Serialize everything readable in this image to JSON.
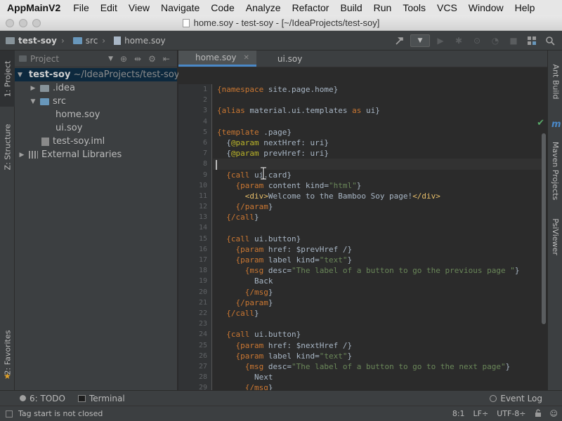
{
  "menubar": {
    "app": "AppMainV2",
    "items": [
      "File",
      "Edit",
      "View",
      "Navigate",
      "Code",
      "Analyze",
      "Refactor",
      "Build",
      "Run",
      "Tools",
      "VCS",
      "Window",
      "Help"
    ]
  },
  "window": {
    "title": "home.soy - test-soy - [~/IdeaProjects/test-soy]"
  },
  "breadcrumbs": [
    "test-soy",
    "src",
    "home.soy"
  ],
  "project_panel": {
    "header": "Project",
    "tree": [
      {
        "label": "test-soy",
        "path": "~/IdeaProjects/test-soy",
        "expanded": "▼"
      },
      {
        "label": ".idea",
        "expanded": "▶"
      },
      {
        "label": "src",
        "expanded": "▼"
      },
      {
        "label": "home.soy"
      },
      {
        "label": "ui.soy"
      },
      {
        "label": "test-soy.iml"
      },
      {
        "label": "External Libraries",
        "expanded": "▶"
      }
    ]
  },
  "left_tabs": {
    "project": "1: Project",
    "structure": "Z: Structure",
    "favorites": "2: Favorites"
  },
  "right_tabs": {
    "ant": "Ant Build",
    "maven": "Maven Projects",
    "psi": "PsiViewer"
  },
  "editor_tabs": [
    {
      "label": "home.soy",
      "active": true
    },
    {
      "label": "ui.soy",
      "active": false
    }
  ],
  "code_lines": [
    "{namespace site.page.home}",
    "",
    "{alias material.ui.templates as ui}",
    "",
    "{template .page}",
    "  {@param nextHref: uri}",
    "  {@param prevHref: uri}",
    "",
    "  {call ui.card}",
    "    {param content kind=\"html\"}",
    "      <div>Welcome to the Bamboo Soy page!</div>",
    "    {/param}",
    "  {/call}",
    "",
    "  {call ui.button}",
    "    {param href: $prevHref /}",
    "    {param label kind=\"text\"}",
    "      {msg desc=\"The label of a button to go the previous page \"}",
    "        Back",
    "      {/msg}",
    "    {/param}",
    "  {/call}",
    "",
    "  {call ui.button}",
    "    {param href: $nextHref /}",
    "    {param label kind=\"text\"}",
    "      {msg desc=\"The label of a button to go to the next page\"}",
    "        Next",
    "      {/msg}"
  ],
  "line_numbers": [
    "1",
    "2",
    "3",
    "4",
    "5",
    "6",
    "7",
    "8",
    "9",
    "10",
    "11",
    "12",
    "13",
    "14",
    "15",
    "16",
    "17",
    "18",
    "19",
    "20",
    "21",
    "22",
    "23",
    "24",
    "25",
    "26",
    "27",
    "28",
    "29"
  ],
  "current_line": 8,
  "toolwindows": {
    "todo": "6: TODO",
    "terminal": "Terminal",
    "event_log": "Event Log"
  },
  "status": {
    "message": "Tag start is not closed",
    "position": "8:1",
    "line_sep": "LF÷",
    "encoding": "UTF-8÷"
  },
  "colors": {
    "keyword": "#cc7832",
    "string": "#6a8759",
    "annotation": "#bbb529",
    "tag": "#e8bf6a"
  }
}
